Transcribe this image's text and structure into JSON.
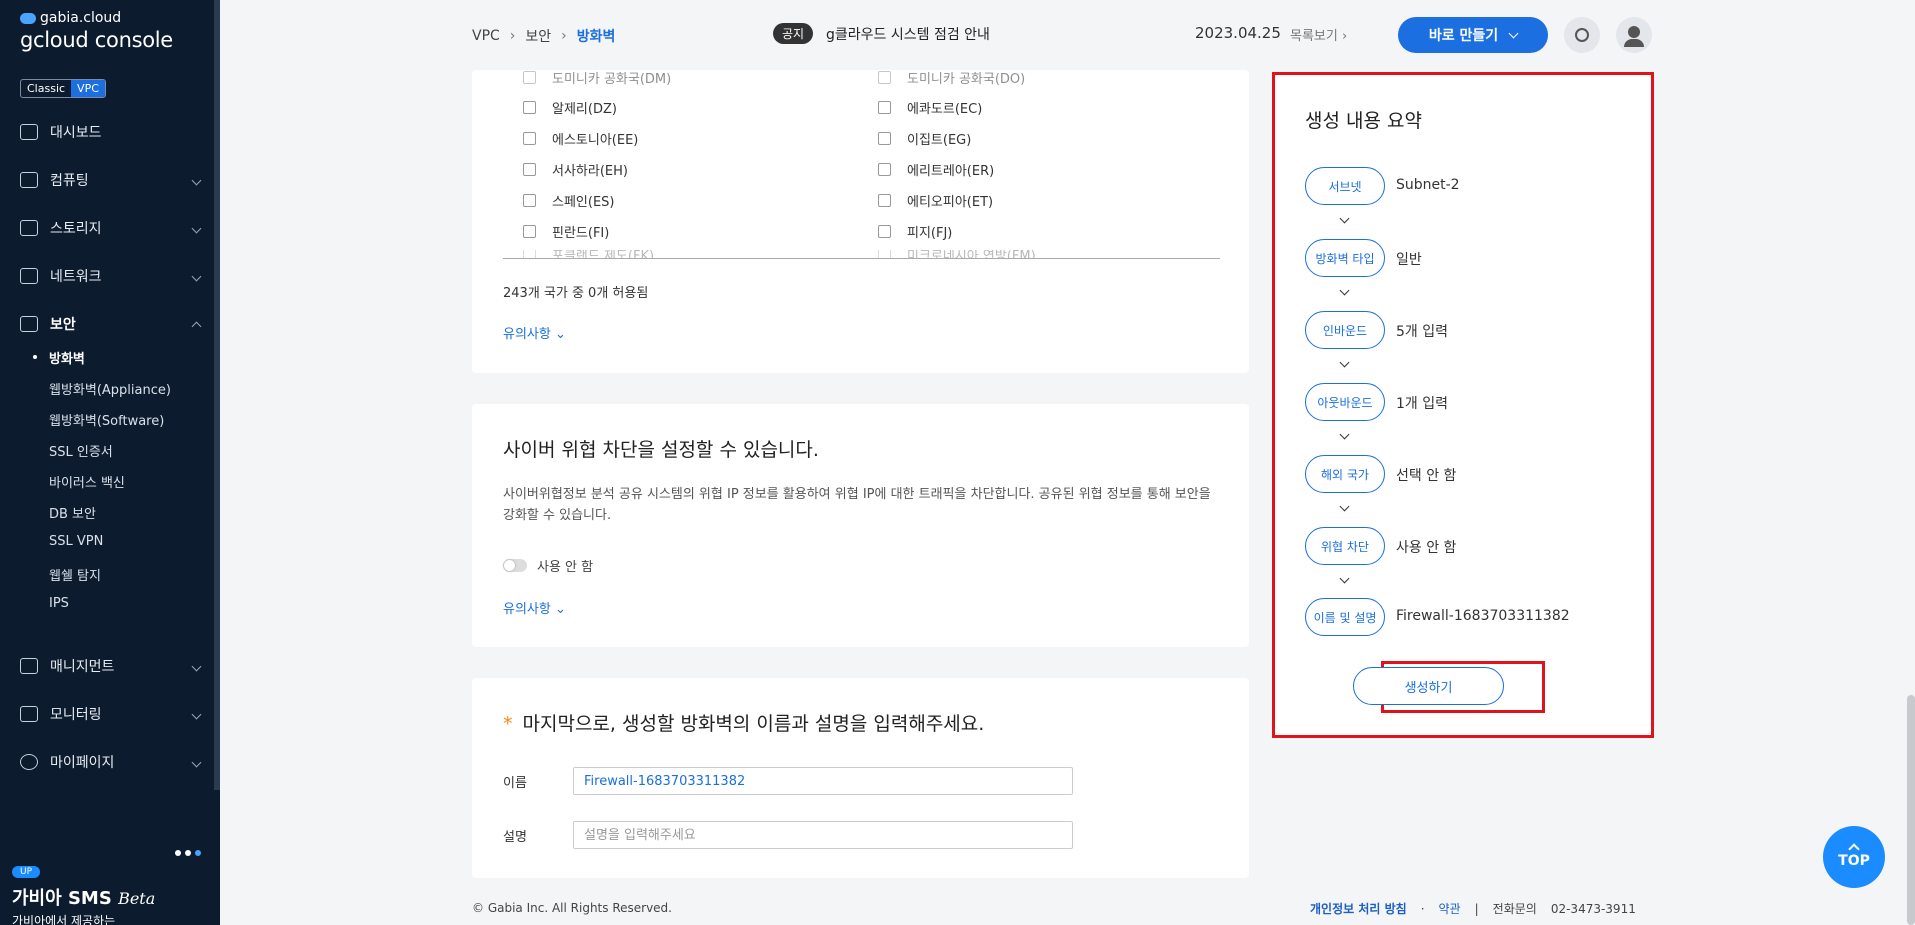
{
  "brand": {
    "small": "gabia.cloud",
    "big": "gcloud console"
  },
  "modes": [
    "Classic",
    "VPC"
  ],
  "nav": {
    "dashboard": "대시보드",
    "computing": "컴퓨팅",
    "storage": "스토리지",
    "network": "네트워크",
    "security": "보안",
    "management": "매니지먼트",
    "monitoring": "모니터링",
    "mypage": "마이페이지"
  },
  "security_sub": [
    "방화벽",
    "웹방화벽(Appliance)",
    "웹방화벽(Software)",
    "SSL 인증서",
    "바이러스 백신",
    "DB 보안",
    "SSL VPN",
    "웹쉘 탐지",
    "IPS"
  ],
  "promo": {
    "badge": "UP",
    "title": "가비아 SMS",
    "beta": "Beta",
    "sub": "가비아에서 제공하는"
  },
  "header": {
    "crumb": [
      "VPC",
      "보안",
      "방화벽"
    ],
    "notice_badge": "공지",
    "notice_text": "g클라우드 시스템 점검 안내",
    "date": "2023.04.25",
    "list_link": "목록보기",
    "make_button": "바로 만들기"
  },
  "countries": {
    "left": [
      "도미니카 공화국(DM)",
      "알제리(DZ)",
      "에스토니아(EE)",
      "서사하라(EH)",
      "스페인(ES)",
      "핀란드(FI)",
      "포클랜드 제도(FK)"
    ],
    "right": [
      "도미니카 공화국(DO)",
      "에콰도르(EC)",
      "이집트(EG)",
      "에리트레아(ER)",
      "에티오피아(ET)",
      "피지(FJ)",
      "미크로네시아 연방(FM)"
    ],
    "count_text": "243개 국가 중 0개 허용됨",
    "note": "유의사항"
  },
  "cyber": {
    "title": "사이버 위협 차단을 설정할 수 있습니다.",
    "desc": "사이버위협정보 분석 공유 시스템의 위협 IP 정보를 활용하여 위협 IP에 대한 트래픽을 차단합니다. 공유된 위협 정보를 통해 보안을 강화할 수 있습니다.",
    "toggle_label": "사용 안 함",
    "note": "유의사항"
  },
  "naming": {
    "star": "*",
    "title": "마지막으로, 생성할 방화벽의 이름과 설명을 입력해주세요.",
    "name_label": "이름",
    "name_value": "Firewall-1683703311382",
    "desc_label": "설명",
    "desc_placeholder": "설명을 입력해주세요"
  },
  "summary": {
    "title": "생성 내용 요약",
    "steps": [
      {
        "label": "서브넷",
        "value": "Subnet-2"
      },
      {
        "label": "방화벽 타입",
        "value": "일반"
      },
      {
        "label": "인바운드",
        "value": "5개 입력"
      },
      {
        "label": "아웃바운드",
        "value": "1개 입력"
      },
      {
        "label": "해외 국가",
        "value": "선택 안 함"
      },
      {
        "label": "위협 차단",
        "value": "사용 안 함"
      },
      {
        "label": "이름 및 설명",
        "value": "Firewall-1683703311382"
      }
    ],
    "create_button": "생성하기"
  },
  "footer": {
    "copyright": "© Gabia Inc. All Rights Reserved.",
    "privacy": "개인정보 처리 방침",
    "terms": "약관",
    "divider": "|",
    "phone_label": "전화문의",
    "phone": "02-3473-3911"
  },
  "top_button": "TOP"
}
